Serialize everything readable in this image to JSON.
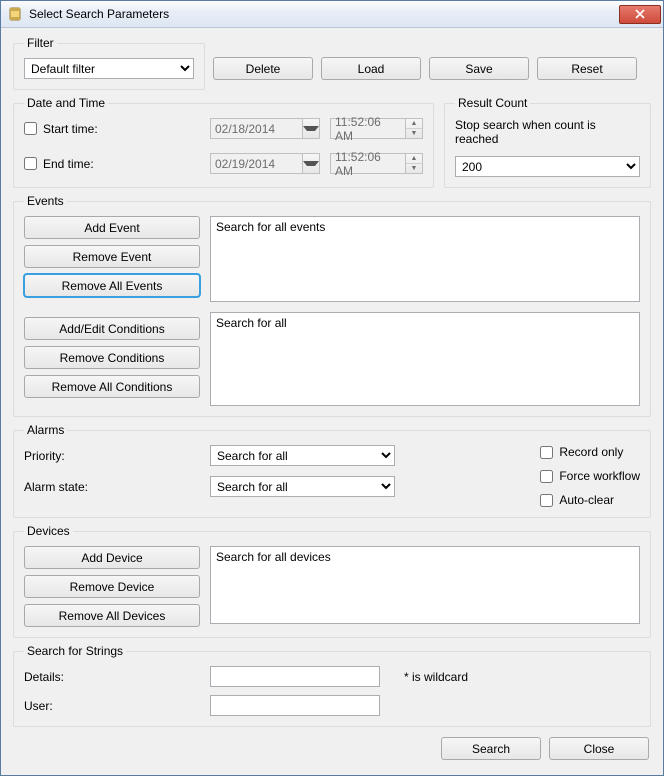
{
  "window": {
    "title": "Select Search Parameters"
  },
  "filter": {
    "legend": "Filter",
    "selected": "Default filter",
    "options": [
      "Default filter"
    ]
  },
  "top_buttons": {
    "delete": "Delete",
    "load": "Load",
    "save": "Save",
    "reset": "Reset"
  },
  "datetime": {
    "legend": "Date and Time",
    "start_label": "Start time:",
    "end_label": "End time:",
    "start_checked": false,
    "end_checked": false,
    "start_date": "02/18/2014",
    "end_date": "02/19/2014",
    "start_time": "11:52:06 AM",
    "end_time": "11:52:06 AM"
  },
  "result_count": {
    "legend": "Result Count",
    "desc": "Stop search when count is reached",
    "value": "200",
    "options": [
      "200"
    ]
  },
  "events": {
    "legend": "Events",
    "add_event": "Add Event",
    "remove_event": "Remove Event",
    "remove_all_events": "Remove All Events",
    "add_edit_conditions": "Add/Edit Conditions",
    "remove_conditions": "Remove Conditions",
    "remove_all_conditions": "Remove All Conditions",
    "events_list_text": "Search for all events",
    "conditions_list_text": "Search for all"
  },
  "alarms": {
    "legend": "Alarms",
    "priority_label": "Priority:",
    "state_label": "Alarm state:",
    "priority_value": "Search for all",
    "state_value": "Search for all",
    "record_only": "Record only",
    "force_workflow": "Force workflow",
    "auto_clear": "Auto-clear",
    "record_only_checked": false,
    "force_workflow_checked": false,
    "auto_clear_checked": false
  },
  "devices": {
    "legend": "Devices",
    "add_device": "Add Device",
    "remove_device": "Remove Device",
    "remove_all_devices": "Remove All Devices",
    "list_text": "Search for all devices"
  },
  "strings": {
    "legend": "Search for Strings",
    "details_label": "Details:",
    "user_label": "User:",
    "details_value": "",
    "user_value": "",
    "wildcard_hint": "* is wildcard"
  },
  "footer": {
    "search": "Search",
    "close": "Close"
  }
}
